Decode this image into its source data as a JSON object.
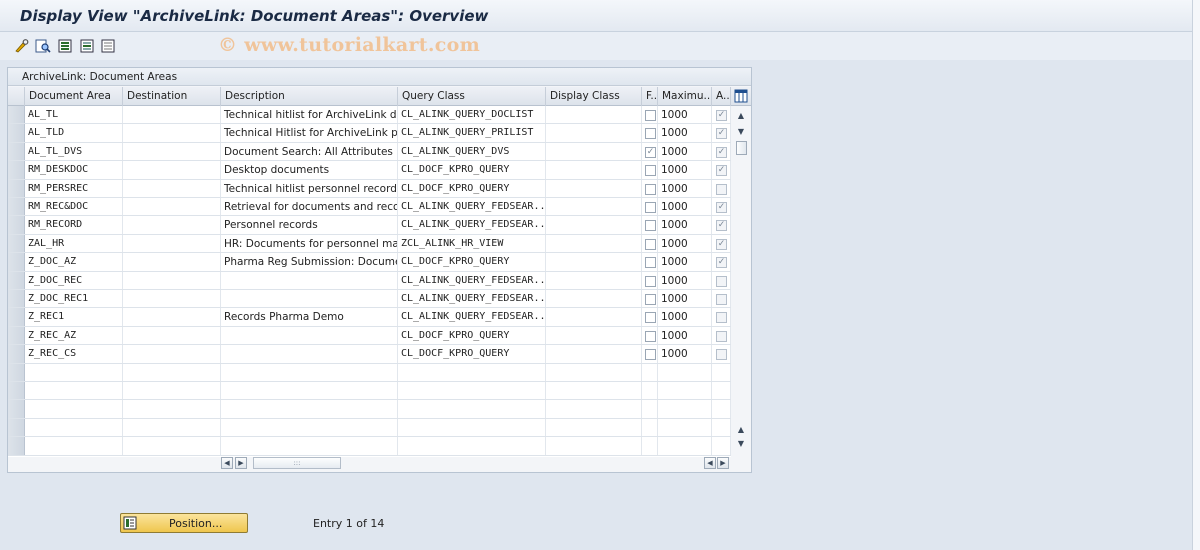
{
  "window": {
    "title": "Display View \"ArchiveLink: Document Areas\": Overview",
    "watermark": "© www.tutorialkart.com"
  },
  "toolbar": {
    "icons": [
      "edit-glasses-icon",
      "find-icon",
      "select-all-icon",
      "select-block-icon",
      "deselect-all-icon"
    ]
  },
  "table": {
    "title": "ArchiveLink: Document Areas",
    "columns": [
      "Document Area",
      "Destination",
      "Description",
      "Query Class",
      "Display Class",
      "F..",
      "Maximu...",
      "A.."
    ],
    "rows": [
      {
        "area": "AL_TL",
        "destination": "",
        "description": "Technical hitlist for ArchiveLink doc...",
        "query": "CL_ALINK_QUERY_DOCLIST",
        "display": "",
        "f": false,
        "max": "1000",
        "a": true
      },
      {
        "area": "AL_TLD",
        "destination": "",
        "description": "Technical Hitlist for ArchiveLink prin...",
        "query": "CL_ALINK_QUERY_PRILIST",
        "display": "",
        "f": false,
        "max": "1000",
        "a": true
      },
      {
        "area": "AL_TL_DVS",
        "destination": "",
        "description": "Document Search: All Attributes",
        "query": "CL_ALINK_QUERY_DVS",
        "display": "",
        "f": true,
        "max": "1000",
        "a": true
      },
      {
        "area": "RM_DESKDOC",
        "destination": "",
        "description": "Desktop documents",
        "query": "CL_DOCF_KPRO_QUERY",
        "display": "",
        "f": false,
        "max": "1000",
        "a": true
      },
      {
        "area": "RM_PERSREC",
        "destination": "",
        "description": "Technical hitlist personnel records",
        "query": "CL_DOCF_KPRO_QUERY",
        "display": "",
        "f": false,
        "max": "1000",
        "a": false
      },
      {
        "area": "RM_REC&DOC",
        "destination": "",
        "description": "Retrieval for documents and records",
        "query": "CL_ALINK_QUERY_FEDSEAR...",
        "display": "",
        "f": false,
        "max": "1000",
        "a": true
      },
      {
        "area": "RM_RECORD",
        "destination": "",
        "description": "Personnel records",
        "query": "CL_ALINK_QUERY_FEDSEAR...",
        "display": "",
        "f": false,
        "max": "1000",
        "a": true
      },
      {
        "area": "ZAL_HR",
        "destination": "",
        "description": "HR: Documents for personnel mast...",
        "query": "ZCL_ALINK_HR_VIEW",
        "display": "",
        "f": false,
        "max": "1000",
        "a": true
      },
      {
        "area": "Z_DOC_AZ",
        "destination": "",
        "description": "Pharma Reg Submission: Document ...",
        "query": "CL_DOCF_KPRO_QUERY",
        "display": "",
        "f": false,
        "max": "1000",
        "a": true
      },
      {
        "area": "Z_DOC_REC",
        "destination": "",
        "description": "",
        "query": "CL_ALINK_QUERY_FEDSEAR...",
        "display": "",
        "f": false,
        "max": "1000",
        "a": false
      },
      {
        "area": "Z_DOC_REC1",
        "destination": "",
        "description": "",
        "query": "CL_ALINK_QUERY_FEDSEAR...",
        "display": "",
        "f": false,
        "max": "1000",
        "a": false
      },
      {
        "area": "Z_REC1",
        "destination": "",
        "description": "Records Pharma Demo",
        "query": "CL_ALINK_QUERY_FEDSEAR...",
        "display": "",
        "f": false,
        "max": "1000",
        "a": false
      },
      {
        "area": "Z_REC_AZ",
        "destination": "",
        "description": "",
        "query": "CL_DOCF_KPRO_QUERY",
        "display": "",
        "f": false,
        "max": "1000",
        "a": false
      },
      {
        "area": "Z_REC_CS",
        "destination": "",
        "description": "",
        "query": "CL_DOCF_KPRO_QUERY",
        "display": "",
        "f": false,
        "max": "1000",
        "a": false
      }
    ],
    "empty_rows": 5
  },
  "footer": {
    "position_label": "Position...",
    "entry_text": "Entry 1 of 14"
  },
  "colors": {
    "accent": "#efc64e",
    "background": "#dfe6ef",
    "watermark": "#f0c49a"
  }
}
